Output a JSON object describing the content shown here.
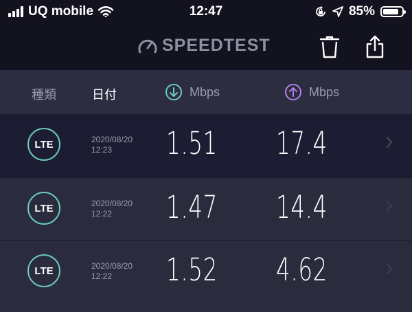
{
  "status_bar": {
    "carrier": "UQ mobile",
    "time": "12:47",
    "battery_percent": "85%",
    "battery_level": 0.85
  },
  "header": {
    "logo_text": "SPEEDTEST",
    "logo_icon": "gauge-icon",
    "delete_icon": "trash-icon",
    "share_icon": "share-icon"
  },
  "columns": {
    "type": "種類",
    "date": "日付",
    "download_unit": "Mbps",
    "upload_unit": "Mbps"
  },
  "colors": {
    "download_accent": "#6bc9be",
    "upload_accent": "#b47ee6",
    "background": "#1a1b2e"
  },
  "results": [
    {
      "network": "LTE",
      "date": "2020/08/20",
      "time": "12:23",
      "download": "1.51",
      "upload": "17.4"
    },
    {
      "network": "LTE",
      "date": "2020/08/20",
      "time": "12:22",
      "download": "1.47",
      "upload": "14.4"
    },
    {
      "network": "LTE",
      "date": "2020/08/20",
      "time": "12:22",
      "download": "1.52",
      "upload": "4.62"
    }
  ]
}
